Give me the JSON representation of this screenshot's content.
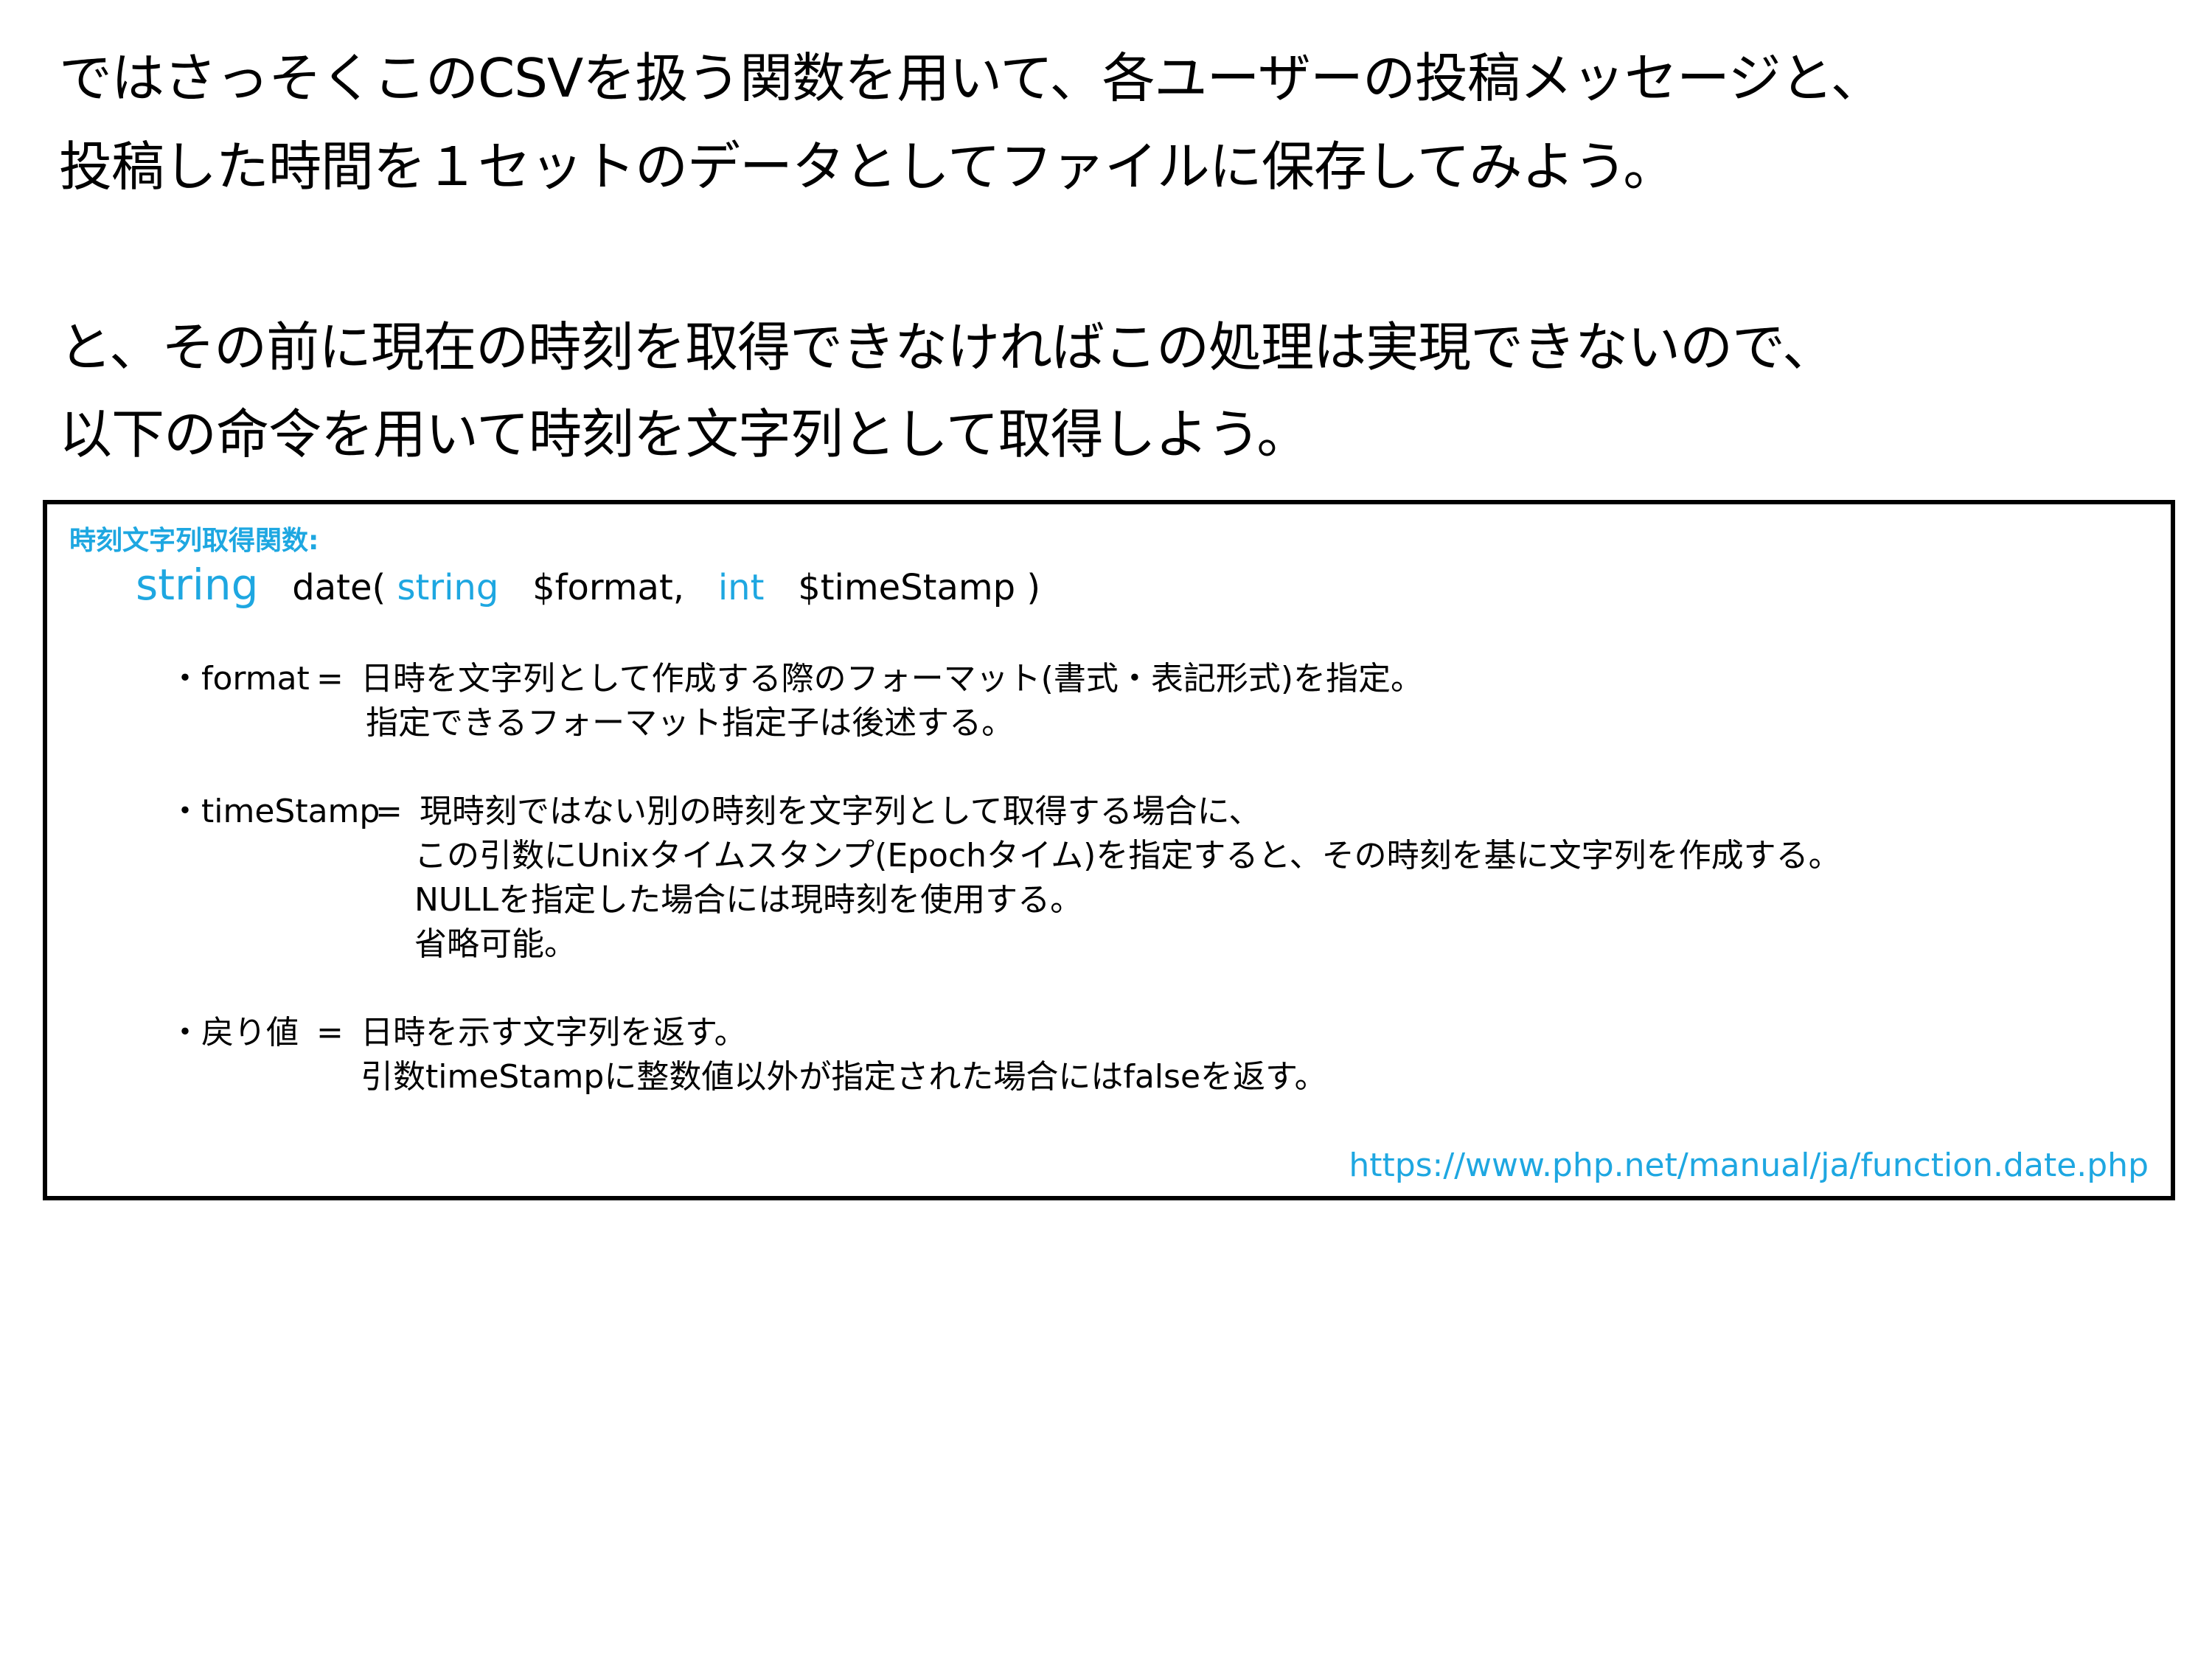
{
  "intro": {
    "line1": "ではさっそくこのCSVを扱う関数を用いて、各ユーザーの投稿メッセージと、",
    "line2": "投稿した時間を１セットのデータとしてファイルに保存してみよう。",
    "line3": "と、その前に現在の時刻を取得できなければこの処理は実現できないので、",
    "line4": "以下の命令を用いて時刻を文字列として取得しよう。"
  },
  "function_box": {
    "label": "時刻文字列取得関数:",
    "signature": {
      "return_type": "string",
      "name": "date(",
      "param1_type": "string",
      "param1_name": "$format,",
      "param2_type": "int",
      "param2_name": "$timeStamp",
      "close": ")"
    },
    "params": {
      "format_key": "・format",
      "format_eq": "=",
      "format_desc1": "日時を文字列として作成する際のフォーマット(書式・表記形式)を指定。",
      "format_desc2": "指定できるフォーマット指定子は後述する。",
      "timestamp_key": "・timeStamp",
      "timestamp_eq": "=",
      "timestamp_desc1": "現時刻ではない別の時刻を文字列として取得する場合に、",
      "timestamp_desc2": "この引数にUnixタイムスタンプ(Epochタイム)を指定すると、その時刻を基に文字列を作成する。",
      "timestamp_desc3": "NULLを指定した場合には現時刻を使用する。",
      "timestamp_desc4": "省略可能。",
      "return_key": "・戻り値",
      "return_eq": "=",
      "return_desc1": "日時を示す文字列を返す。",
      "return_desc2": "引数timeStampに整数値以外が指定された場合にはfalseを返す。"
    },
    "source_url": "https://www.php.net/manual/ja/function.date.php"
  },
  "colors": {
    "accent": "#1ea7e1",
    "text": "#000000",
    "border": "#000000"
  }
}
